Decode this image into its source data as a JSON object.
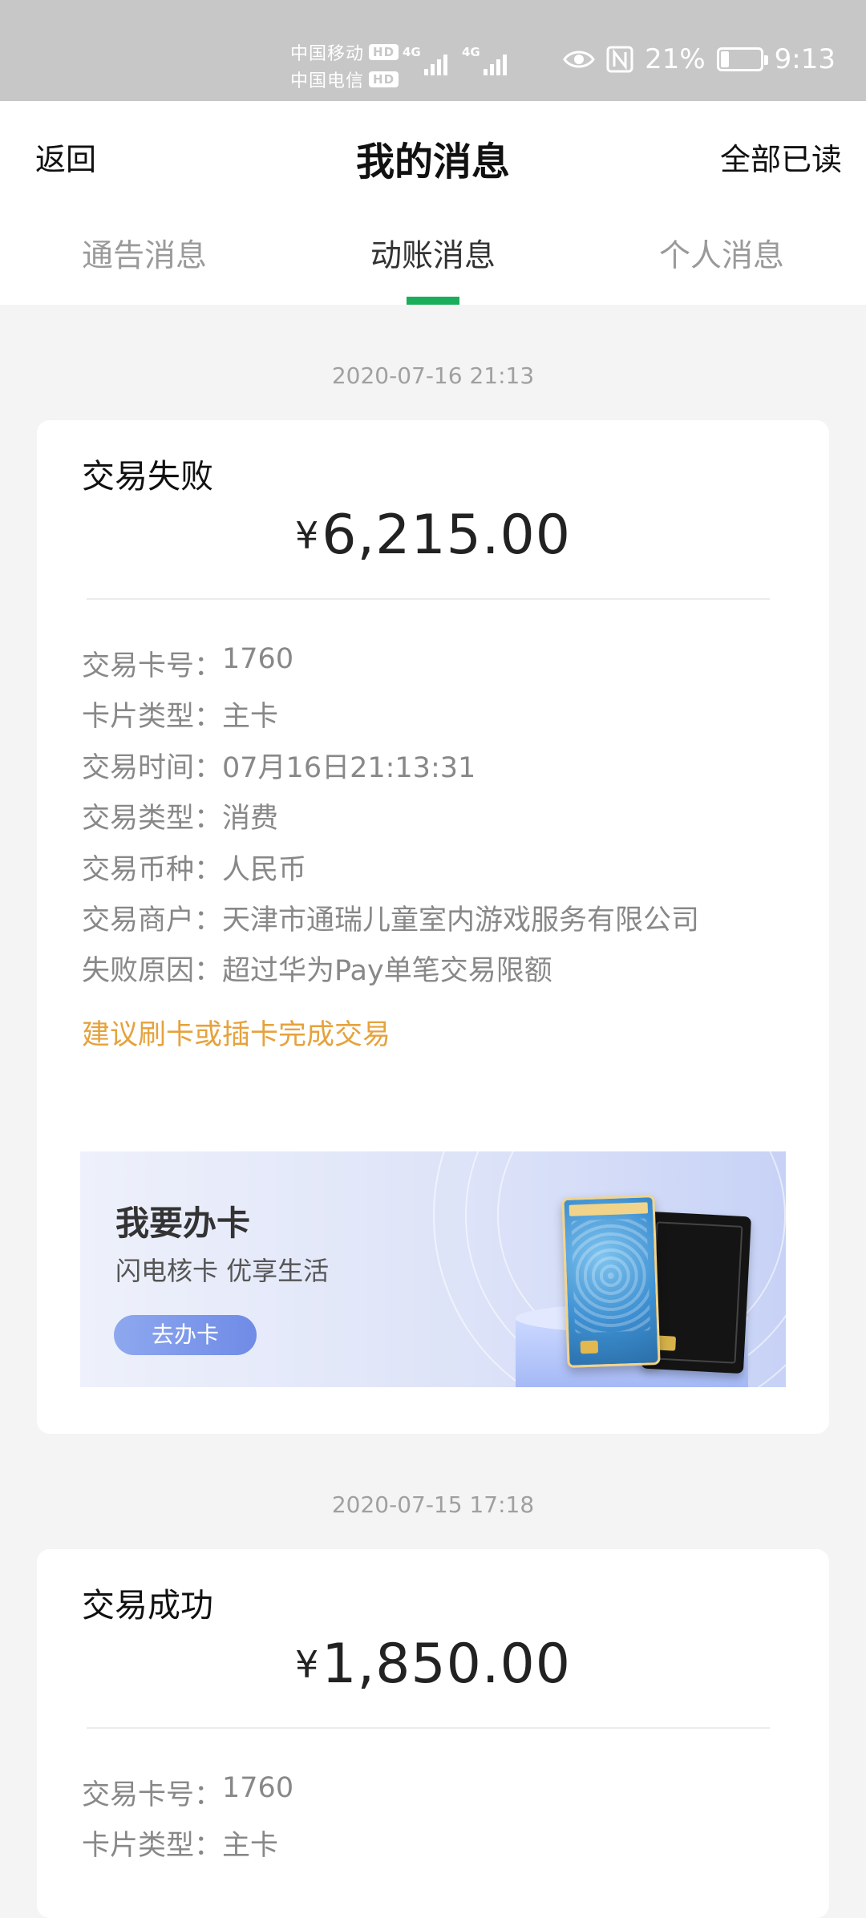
{
  "status_bar": {
    "carrier_1": "中国移动",
    "carrier_2": "中国电信",
    "hd_badge": "HD",
    "network_1": "4G",
    "network_2": "4G",
    "battery_percent": "21%",
    "battery_level": 0.21,
    "time": "9:13",
    "nfc_icon": "N"
  },
  "header": {
    "back_label": "返回",
    "title": "我的消息",
    "mark_all_read_label": "全部已读"
  },
  "tabs": [
    {
      "label": "通告消息",
      "active": false
    },
    {
      "label": "动账消息",
      "active": true
    },
    {
      "label": "个人消息",
      "active": false
    }
  ],
  "accent_color": "#1aad5c",
  "messages": [
    {
      "timestamp": "2020-07-16 21:13",
      "status": "交易失败",
      "currency_symbol": "¥",
      "amount": "6,215.00",
      "details": [
        {
          "key": "交易卡号：",
          "value": "1760"
        },
        {
          "key": "卡片类型：",
          "value": "主卡"
        },
        {
          "key": "交易时间：",
          "value": "07月16日21:13:31"
        },
        {
          "key": "交易类型：",
          "value": "消费"
        },
        {
          "key": "交易币种：",
          "value": "人民币"
        },
        {
          "key": "交易商户：",
          "value": "天津市通瑞儿童室内游戏服务有限公司"
        },
        {
          "key": "失败原因：",
          "value": "超过华为Pay单笔交易限额"
        }
      ],
      "advice": "建议刷卡或插卡完成交易",
      "banner": {
        "title": "我要办卡",
        "subtitle": "闪电核卡 优享生活",
        "button_label": "去办卡"
      }
    },
    {
      "timestamp": "2020-07-15 17:18",
      "status": "交易成功",
      "currency_symbol": "¥",
      "amount": "1,850.00",
      "details": [
        {
          "key": "交易卡号：",
          "value": "1760"
        },
        {
          "key": "卡片类型：",
          "value": "主卡"
        }
      ]
    }
  ]
}
